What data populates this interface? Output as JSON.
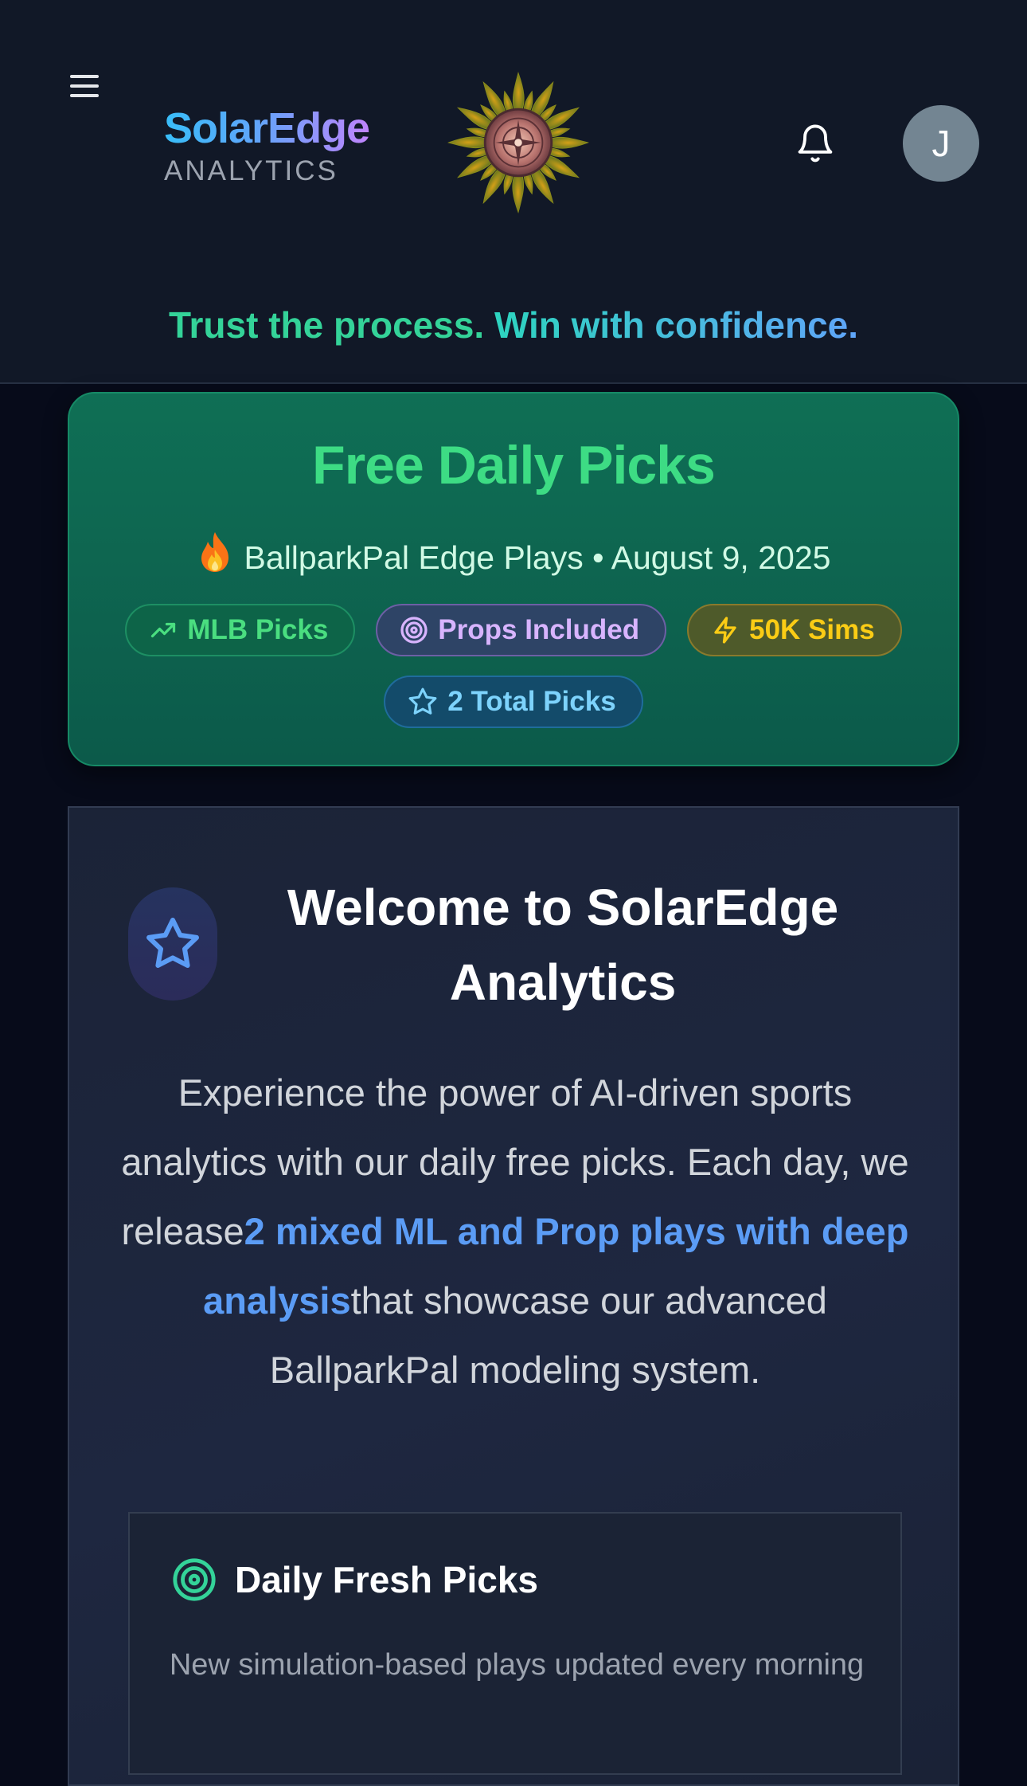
{
  "header": {
    "brand_name": "SolarEdge",
    "brand_sub": "ANALYTICS",
    "avatar_initial": "J",
    "tagline_part1": "Trust the process.",
    "tagline_part2": "Win with confidence.",
    "icons": [
      "menu-icon",
      "sun-logo",
      "bell-icon"
    ]
  },
  "picks_card": {
    "title": "Free Daily Picks",
    "subtitle": "BallparkPal Edge Plays • August 9, 2025",
    "badges": [
      {
        "label": "MLB Picks",
        "icon": "trending-up-icon"
      },
      {
        "label": "Props Included",
        "icon": "target-icon"
      },
      {
        "label": "50K Sims",
        "icon": "lightning-icon"
      },
      {
        "label": "2 Total Picks",
        "icon": "star-icon"
      }
    ],
    "colors": {
      "title": "#3ddc84",
      "background": "#0f6f55"
    }
  },
  "welcome_card": {
    "title": "Welcome to SolarEdge Analytics",
    "body_start": "Experience the power of AI-driven sports analytics with our daily free picks. Each day, we release",
    "body_highlight": "2 mixed ML and Prop plays with deep analysis",
    "body_end": "that showcase our advanced BallparkPal modeling system.",
    "feature": {
      "title": "Daily Fresh Picks",
      "description": "New simulation-based plays updated every morning",
      "icon": "target-icon"
    }
  }
}
